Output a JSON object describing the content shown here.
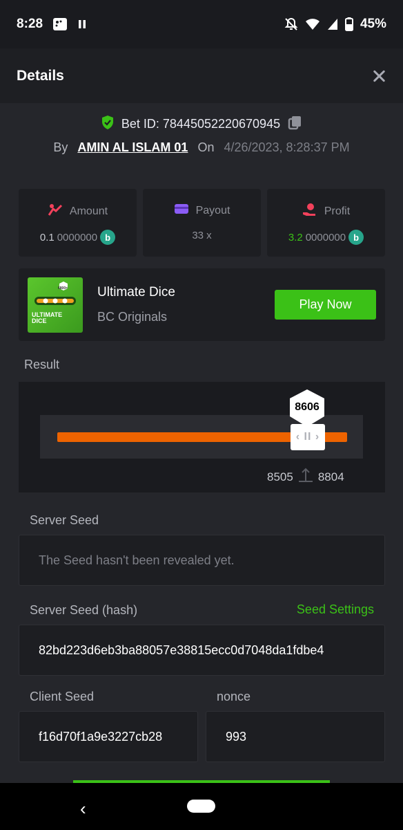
{
  "status_bar": {
    "time": "8:28",
    "battery": "45%",
    "icons": [
      "gallery-icon",
      "pause-icon",
      "bell-off-icon",
      "wifi-icon",
      "signal-icon",
      "battery-icon"
    ]
  },
  "header": {
    "title": "Details",
    "close_icon": "close-icon"
  },
  "bet": {
    "id_label": "Bet ID: 78445052220670945",
    "by_label": "By",
    "user": "AMIN AL ISLAM 01",
    "on_label": "On",
    "date": "4/26/2023, 8:28:37 PM"
  },
  "stats": {
    "amount": {
      "label": "Amount",
      "value_main": "0.1",
      "value_rest": "0000000"
    },
    "payout": {
      "label": "Payout",
      "value": "33 x"
    },
    "profit": {
      "label": "Profit",
      "value_main": "3.2",
      "value_rest": "0000000"
    }
  },
  "game": {
    "name": "Ultimate Dice",
    "provider": "BC Originals",
    "play_label": "Play Now",
    "thumb_text": "ULTIMATE DICE",
    "thumb_badge": "6800×"
  },
  "result": {
    "label": "Result",
    "value": "8606",
    "range_low": "8505",
    "range_high": "8804"
  },
  "seeds": {
    "server_seed_label": "Server Seed",
    "server_seed_value": "The Seed hasn't been revealed yet.",
    "server_hash_label": "Server Seed (hash)",
    "seed_settings_label": "Seed Settings",
    "server_hash_value": "82bd223d6eb3ba88057e38815ecc0d7048da1fdbe4",
    "client_seed_label": "Client Seed",
    "client_seed_value": "f16d70f1a9e3227cb28",
    "nonce_label": "nonce",
    "nonce_value": "993"
  },
  "colors": {
    "accent_green": "#3bc117",
    "track_orange": "#ed6300",
    "background": "#25262b",
    "card": "#1d1e22"
  }
}
